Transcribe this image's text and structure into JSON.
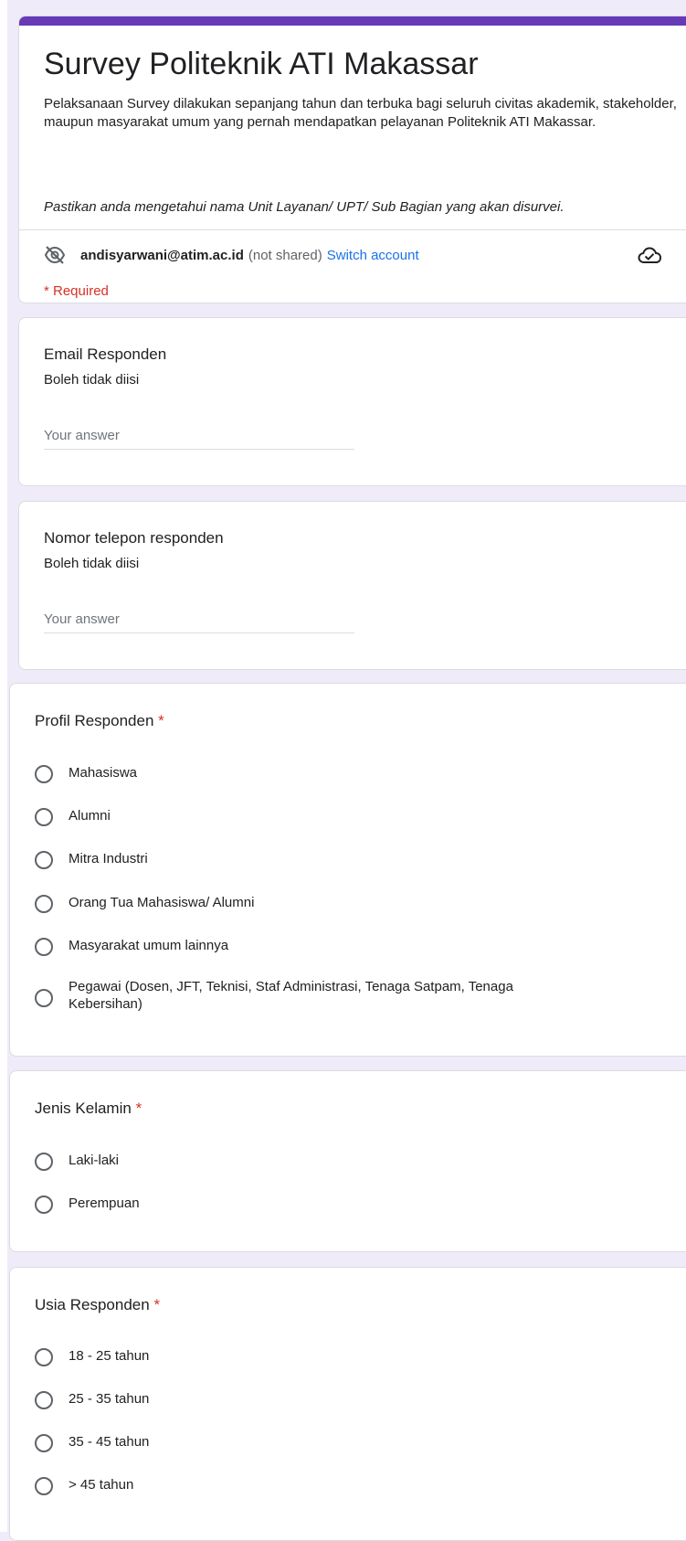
{
  "form": {
    "title": "Survey Politeknik ATI Makassar",
    "description": "Pelaksanaan Survey dilakukan sepanjang tahun dan terbuka bagi seluruh civitas akademik, stakeholder, maupun masyarakat umum yang pernah mendapatkan pelayanan Politeknik ATI Makassar.",
    "note": "Pastikan anda mengetahui nama Unit Layanan/ UPT/ Sub Bagian yang akan disurvei.",
    "account": {
      "email": "andisyarwani@atim.ac.id",
      "not_shared": "(not shared)",
      "switch_label": "Switch account"
    },
    "required_note": "* Required",
    "icons": {
      "eye": "eye-off-icon",
      "cloud": "cloud-saved-icon"
    },
    "accent_color": "#673ab7",
    "link_color": "#1a73e8",
    "required_color": "#d93025"
  },
  "questions": {
    "email": {
      "title": "Email Responden",
      "help": "Boleh tidak diisi",
      "placeholder": "Your answer",
      "value": ""
    },
    "phone": {
      "title": "Nomor telepon responden",
      "help": "Boleh tidak diisi",
      "placeholder": "Your answer",
      "value": ""
    },
    "profil": {
      "title": "Profil Responden",
      "required_mark": "*",
      "options": [
        "Mahasiswa",
        "Alumni",
        "Mitra Industri",
        "Orang Tua Mahasiswa/ Alumni",
        "Masyarakat umum lainnya",
        "Pegawai (Dosen, JFT, Teknisi, Staf Administrasi, Tenaga Satpam, Tenaga Kebersihan)"
      ]
    },
    "gender": {
      "title": "Jenis Kelamin",
      "required_mark": "*",
      "options": [
        "Laki-laki",
        "Perempuan"
      ]
    },
    "age": {
      "title": "Usia Responden",
      "required_mark": "*",
      "options": [
        "18 - 25 tahun",
        "25 - 35 tahun",
        "35 - 45 tahun",
        "> 45 tahun"
      ]
    }
  }
}
